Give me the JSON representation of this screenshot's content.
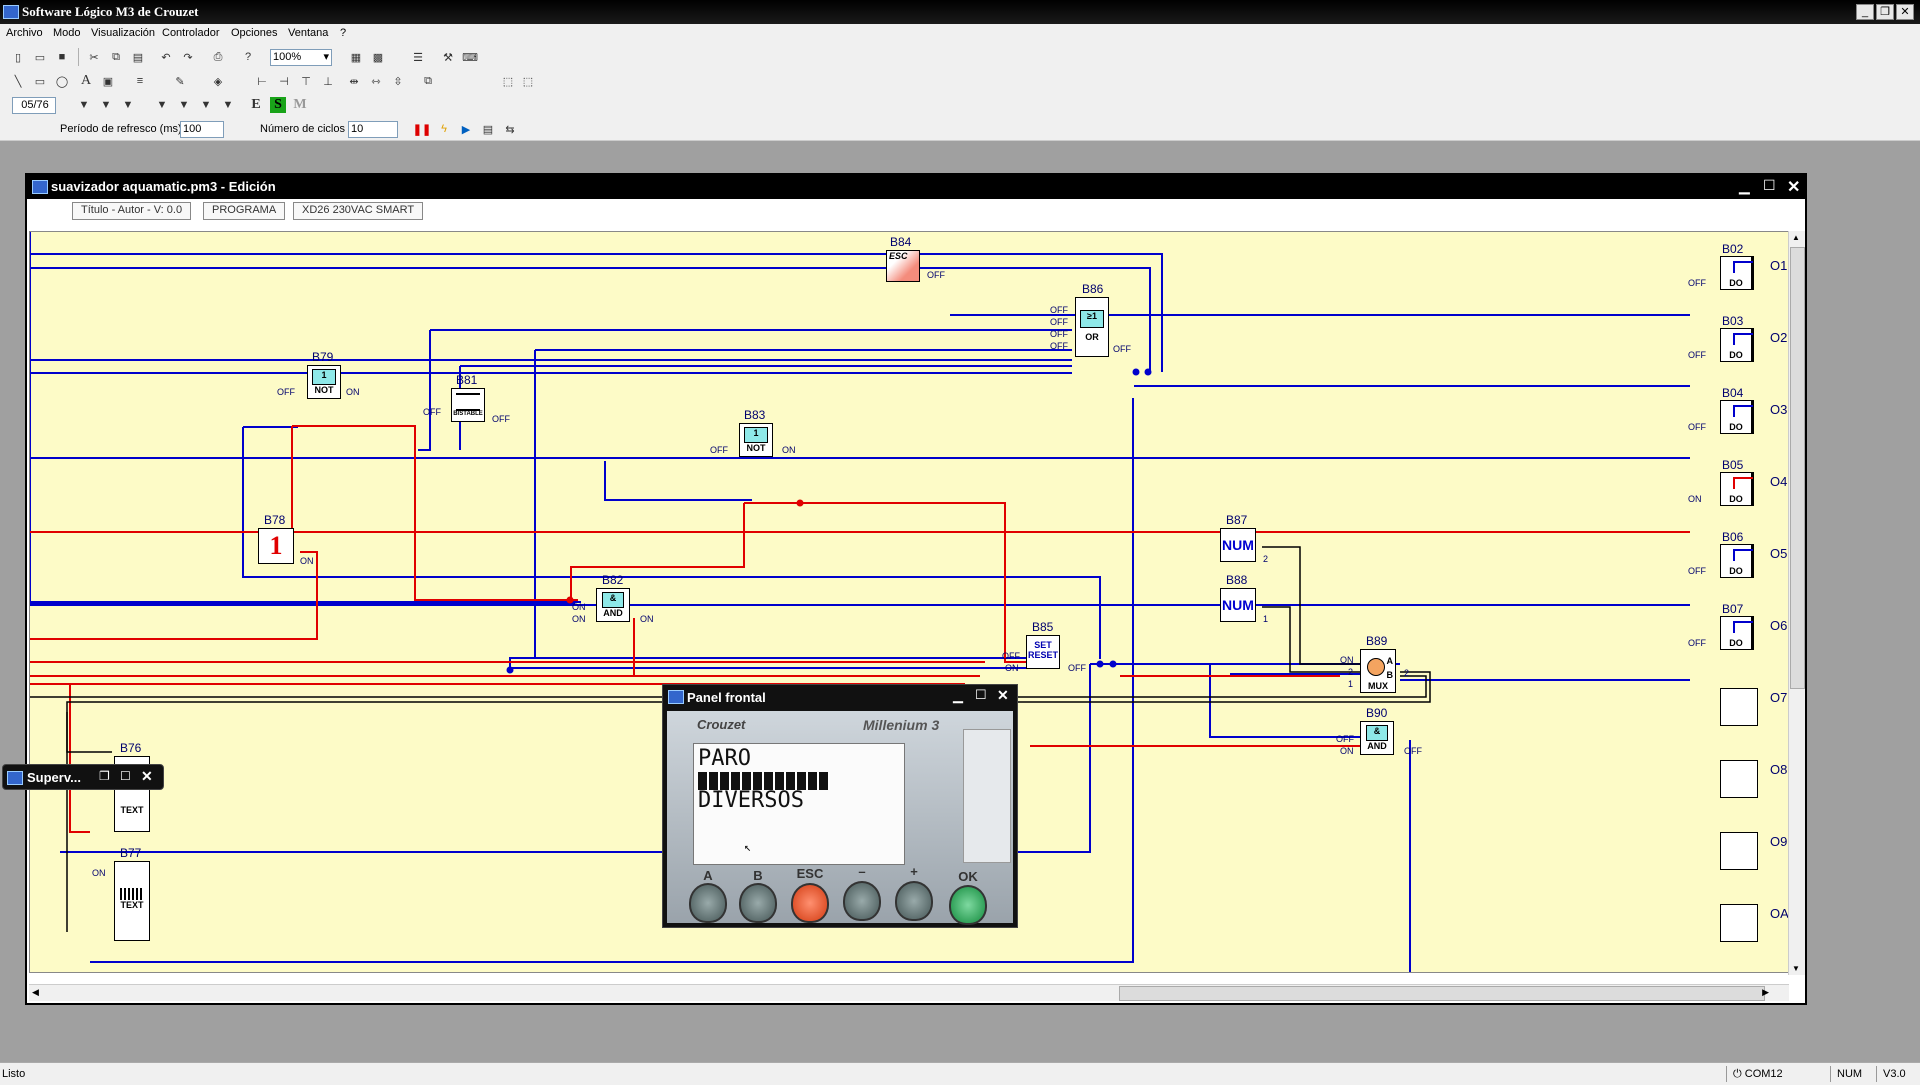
{
  "app": {
    "title": "Software Lógico M3 de Crouzet"
  },
  "menu": [
    "Archivo",
    "Modo",
    "Visualización",
    "Controlador",
    "Opciones",
    "Ventana",
    "?"
  ],
  "toolbar": {
    "zoom": "100%",
    "page_indicator": "05/76",
    "refresh_label": "Período de refresco (ms)",
    "refresh_value": "100",
    "cycles_label": "Número de ciclos",
    "cycles_value": "10",
    "mode_e": "E",
    "mode_s": "S",
    "mode_m": "M"
  },
  "editor": {
    "title": "suavizador aquamatic.pm3 - Edición",
    "info": [
      "Título - Autor - V: 0.0",
      "PROGRAMA",
      "XD26 230VAC SMART"
    ]
  },
  "blocks": {
    "b84": {
      "id": "B84",
      "text": "ESC",
      "pin_out": "OFF"
    },
    "b86": {
      "id": "B86",
      "text": "OR",
      "sym": "≥1",
      "pins_in": [
        "OFF",
        "OFF",
        "OFF",
        "OFF"
      ],
      "pin_out": "OFF"
    },
    "b79": {
      "id": "B79",
      "text": "NOT",
      "pin_in": "OFF",
      "pin_out": "ON"
    },
    "b81": {
      "id": "B81",
      "text": "BISTABLE",
      "pin_in": "OFF",
      "pin_out": "OFF"
    },
    "b83": {
      "id": "B83",
      "text": "NOT",
      "pin_in": "OFF",
      "pin_out": "ON"
    },
    "b78": {
      "id": "B78",
      "text": "1",
      "pin_out": "ON"
    },
    "b82": {
      "id": "B82",
      "text": "AND",
      "pins_in": [
        "ON",
        "ON"
      ],
      "pin_out": "ON"
    },
    "b85": {
      "id": "B85",
      "text_set": "SET",
      "text_reset": "RESET",
      "pins_in": [
        "OFF",
        "ON"
      ],
      "pin_out": "OFF"
    },
    "b87": {
      "id": "B87",
      "text": "NUM",
      "pin_out": "2"
    },
    "b88": {
      "id": "B88",
      "text": "NUM",
      "pin_out": "1"
    },
    "b89": {
      "id": "B89",
      "text": "MUX",
      "pin_a": "A",
      "pin_b": "B",
      "pins_in": [
        "ON",
        "2",
        "1"
      ],
      "pin_out": "2"
    },
    "b90": {
      "id": "B90",
      "text": "AND",
      "pins_in": [
        "OFF",
        "ON"
      ],
      "pin_out": "OFF"
    },
    "b76": {
      "id": "B76",
      "text": "TEXT"
    },
    "b77": {
      "id": "B77",
      "text": "TEXT",
      "pin_in": "ON"
    }
  },
  "outputs": [
    {
      "id": "B02",
      "name": "O1",
      "state": "OFF",
      "text": "DO"
    },
    {
      "id": "B03",
      "name": "O2",
      "state": "OFF",
      "text": "DO"
    },
    {
      "id": "B04",
      "name": "O3",
      "state": "OFF",
      "text": "DO"
    },
    {
      "id": "B05",
      "name": "O4",
      "state": "ON",
      "text": "DO"
    },
    {
      "id": "B06",
      "name": "O5",
      "state": "OFF",
      "text": "DO"
    },
    {
      "id": "B07",
      "name": "O6",
      "state": "OFF",
      "text": "DO"
    },
    {
      "id": "",
      "name": "O7"
    },
    {
      "id": "",
      "name": "O8"
    },
    {
      "id": "",
      "name": "O9"
    },
    {
      "id": "",
      "name": "OA"
    }
  ],
  "panel": {
    "title": "Panel frontal",
    "brand": "Crouzet",
    "model": "Millenium 3",
    "lcd_line1": "PARO",
    "lcd_line3": "DIVERSOS",
    "buttons": [
      "A",
      "B",
      "ESC",
      "–",
      "+",
      "OK"
    ]
  },
  "superv": {
    "title": "Superv..."
  },
  "status": {
    "left": "Listo",
    "port": "COM12",
    "num": "NUM",
    "version": "V3.0"
  },
  "colors": {
    "wire_off": "#0000cc",
    "wire_on": "#e00000",
    "canvas": "#fdfbc7"
  }
}
